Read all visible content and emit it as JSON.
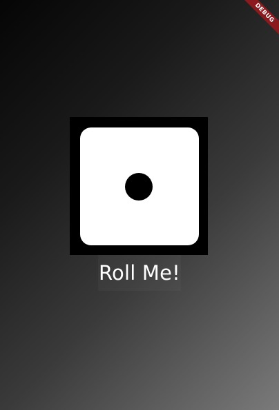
{
  "app": {
    "debug_banner": "DEBUG"
  },
  "dice": {
    "face_value": 1,
    "icon": "dice-one-icon"
  },
  "button": {
    "label": "Roll Me!"
  },
  "colors": {
    "debug_banner": "#8b1a1f",
    "dice_face": "#ffffff",
    "dice_frame": "#000000",
    "text": "#ffffff"
  }
}
